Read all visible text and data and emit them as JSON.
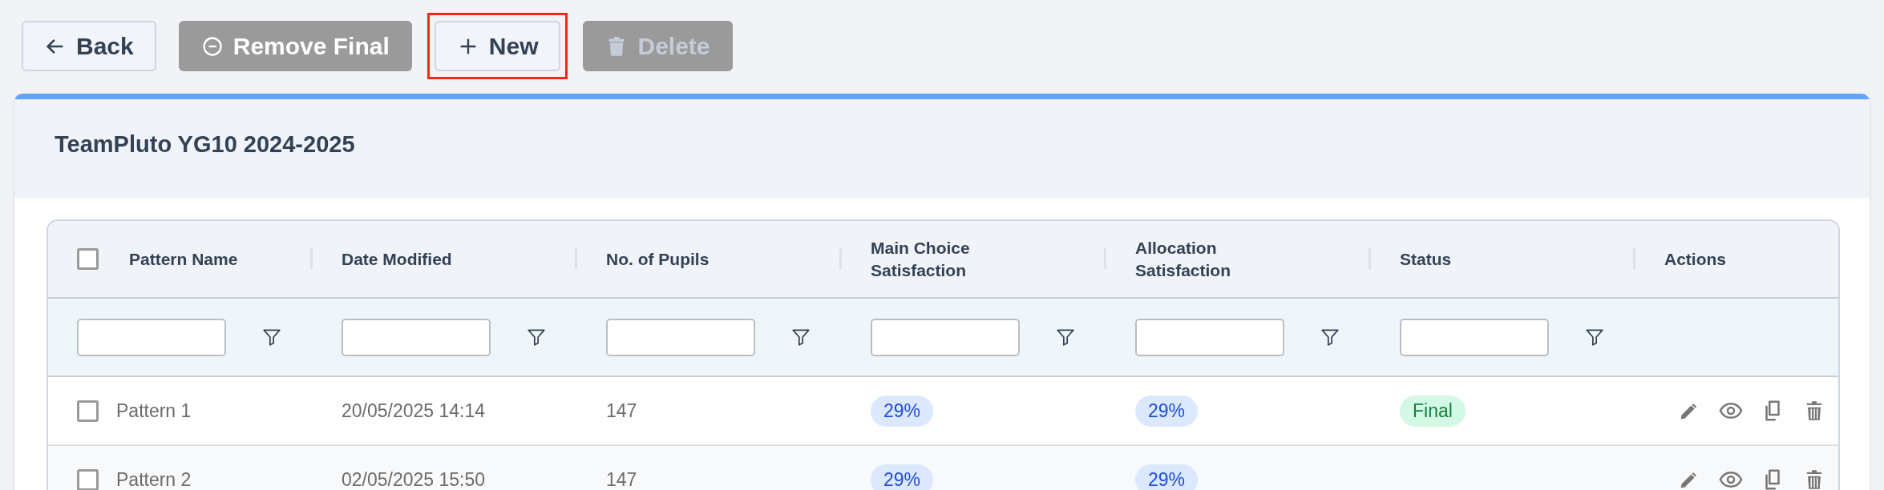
{
  "toolbar": [
    {
      "kind": "back",
      "label": "Back",
      "disabled": false,
      "highlighted": false
    },
    {
      "kind": "remove",
      "label": "Remove Final",
      "disabled": false,
      "highlighted": false
    },
    {
      "kind": "new",
      "label": "New",
      "disabled": false,
      "highlighted": true
    },
    {
      "kind": "delete",
      "label": "Delete",
      "disabled": true,
      "highlighted": false
    }
  ],
  "card": {
    "title": "TeamPluto YG10 2024-2025"
  },
  "table": {
    "select_all": {
      "checked": false
    },
    "columns": [
      {
        "label": "Pattern Name",
        "filter": true
      },
      {
        "label": "Date Modified",
        "filter": true
      },
      {
        "label": "No. of Pupils",
        "filter": true
      },
      {
        "label": "Main Choice Satisfaction",
        "filter": true
      },
      {
        "label": "Allocation Satisfaction",
        "filter": true
      },
      {
        "label": "Status",
        "filter": true
      },
      {
        "label": "Actions",
        "filter": false
      }
    ],
    "rows": [
      {
        "checked": false,
        "name": "Pattern 1",
        "date": "20/05/2025 14:14",
        "pupils": "147",
        "main_choice": "29%",
        "allocation": "29%",
        "status": "Final"
      },
      {
        "checked": false,
        "name": "Pattern 2",
        "date": "02/05/2025 15:50",
        "pupils": "147",
        "main_choice": "29%",
        "allocation": "29%"
      }
    ]
  }
}
